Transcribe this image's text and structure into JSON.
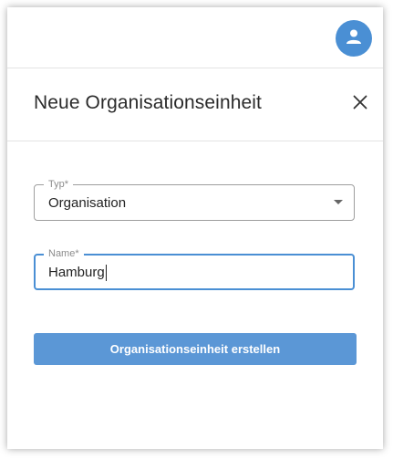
{
  "topbar": {
    "avatar_icon": "user-icon",
    "accent_color": "#4a8fd4"
  },
  "dialog": {
    "title": "Neue Organisationseinheit",
    "close_icon": "close-icon"
  },
  "form": {
    "type_field": {
      "label": "Typ*",
      "value": "Organisation",
      "icon": "chevron-down-icon"
    },
    "name_field": {
      "label": "Name*",
      "value": "Hamburg"
    },
    "submit_label": "Organisationseinheit erstellen",
    "submit_color": "#5b97d6"
  }
}
